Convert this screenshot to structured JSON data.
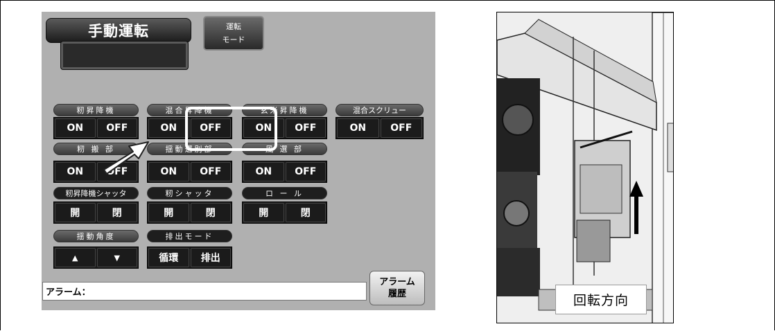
{
  "panel": {
    "title": "手動運転",
    "mode_button": {
      "line1": "運転",
      "line2": "モード"
    },
    "groups": [
      {
        "label": "籾昇降機",
        "buttons": [
          "ON",
          "OFF"
        ]
      },
      {
        "label": "混合昇降機",
        "buttons": [
          "ON",
          "OFF"
        ]
      },
      {
        "label": "玄米昇降機",
        "buttons": [
          "ON",
          "OFF"
        ]
      },
      {
        "label": "混合スクリュー",
        "buttons": [
          "ON",
          "OFF"
        ]
      },
      {
        "label": "籾 搬 部",
        "buttons": [
          "ON",
          "OFF"
        ]
      },
      {
        "label": "揺動選別部",
        "buttons": [
          "ON",
          "OFF"
        ]
      },
      {
        "label": "風 選 部",
        "buttons": [
          "ON",
          "OFF"
        ]
      },
      {
        "label": "籾昇降機シャッタ",
        "buttons": [
          "開",
          "閉"
        ]
      },
      {
        "label": "籾シャッタ",
        "buttons": [
          "開",
          "閉"
        ]
      },
      {
        "label": "ロ ー ル",
        "buttons": [
          "開",
          "閉"
        ]
      },
      {
        "label": "揺動角度",
        "buttons": [
          "▲",
          "▼"
        ]
      },
      {
        "label": "排出モード",
        "buttons": [
          "循環",
          "排出"
        ]
      }
    ],
    "alarm_label": "アラーム：",
    "alarm_history": {
      "line1": "アラーム",
      "line2": "履歴"
    }
  },
  "photo": {
    "label": "回転方向"
  },
  "colors": {
    "panel_bg": "#b0b0b0",
    "button_bg": "#1b1b1b",
    "highlight": "#ffffff"
  }
}
